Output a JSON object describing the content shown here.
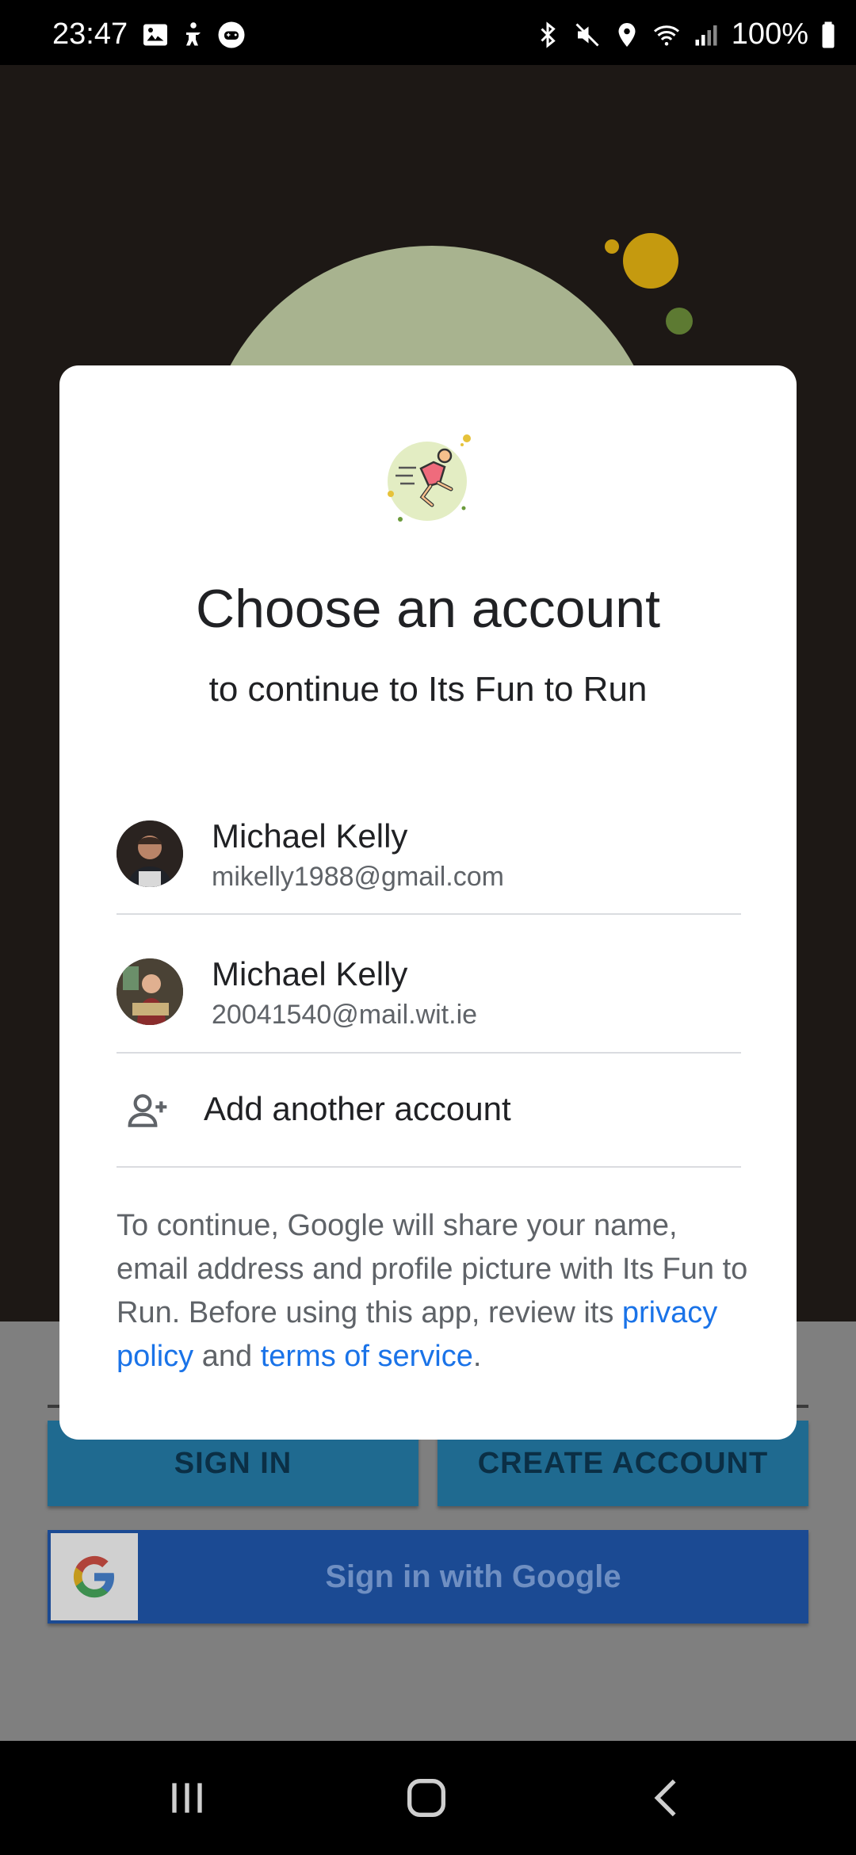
{
  "status_bar": {
    "time": "23:47",
    "battery": "100%",
    "left_icons": [
      "image-icon",
      "accessibility-icon",
      "game-controller-icon"
    ],
    "right_icons": [
      "bluetooth-icon",
      "vibrate-icon",
      "location-icon",
      "wifi-icon",
      "signal-icon",
      "battery-icon"
    ]
  },
  "background_app": {
    "sign_in_label": "SIGN IN",
    "create_account_label": "CREATE ACCOUNT",
    "google_sign_in_label": "Sign in with Google"
  },
  "dialog": {
    "title": "Choose an account",
    "subtitle": "to continue to Its Fun to Run",
    "accounts": [
      {
        "name": "Michael Kelly",
        "email": "mikelly1988@gmail.com"
      },
      {
        "name": "Michael Kelly",
        "email": "20041540@mail.wit.ie"
      }
    ],
    "add_account_label": "Add another account",
    "legal": {
      "prefix": "To continue, Google will share your name, email address and profile picture with Its Fun to Run. Before using this app, review its ",
      "privacy_link": "privacy policy",
      "middle": " and ",
      "terms_link": "terms of service",
      "suffix": "."
    }
  },
  "colors": {
    "link": "#1a73e8",
    "dialog_bg": "#ffffff",
    "dim_overlay": "#7f7f7f"
  }
}
